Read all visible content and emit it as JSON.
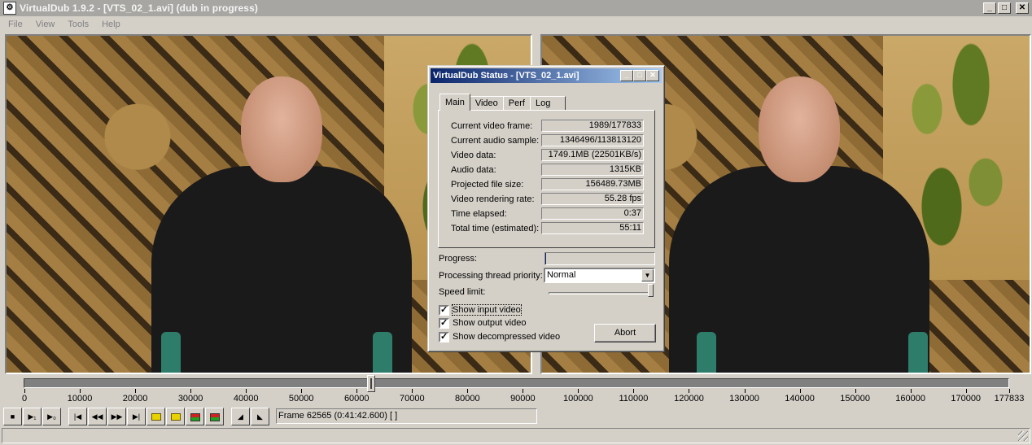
{
  "window": {
    "title": "VirtualDub 1.9.2 - [VTS_02_1.avi] (dub in progress)",
    "icon_glyph": "⚙",
    "minimize": "_",
    "maximize": "□",
    "close": "✕"
  },
  "menu": [
    "File",
    "View",
    "Tools",
    "Help"
  ],
  "status_dialog": {
    "title": "VirtualDub Status - [VTS_02_1.avi]",
    "tabs": [
      "Main",
      "Video",
      "Perf",
      "Log"
    ],
    "active_tab": "Main",
    "stats": [
      {
        "label": "Current video frame:",
        "value": "1989/177833"
      },
      {
        "label": "Current audio sample:",
        "value": "1346496/113813120"
      },
      {
        "label": "Video data:",
        "value": "1749.1MB (22501KB/s)"
      },
      {
        "label": "Audio data:",
        "value": "1315KB"
      },
      {
        "label": "Projected file size:",
        "value": "156489.73MB"
      },
      {
        "label": "Video rendering rate:",
        "value": "55.28 fps"
      },
      {
        "label": "Time elapsed:",
        "value": "0:37"
      },
      {
        "label": "Total time (estimated):",
        "value": "55:11"
      }
    ],
    "progress_label": "Progress:",
    "progress_fraction": 0.011,
    "priority_label": "Processing thread priority:",
    "priority_value": "Normal",
    "speed_label": "Speed limit:",
    "speed_fraction": 1.0,
    "checkboxes": [
      {
        "label": "Show input video",
        "checked": true
      },
      {
        "label": "Show output video",
        "checked": true
      },
      {
        "label": "Show decompressed video",
        "checked": true
      }
    ],
    "abort_label": "Abort"
  },
  "timeline": {
    "max": 177833,
    "position": 62565,
    "ticks": [
      "0",
      "10000",
      "20000",
      "30000",
      "40000",
      "50000",
      "60000",
      "70000",
      "80000",
      "90000",
      "100000",
      "110000",
      "120000",
      "130000",
      "140000",
      "150000",
      "160000",
      "170000",
      "177833"
    ]
  },
  "toolbar": {
    "buttons": [
      {
        "name": "stop-button",
        "glyph": "■"
      },
      {
        "name": "play-input-button",
        "glyph": "▶₁"
      },
      {
        "name": "play-output-button",
        "glyph": "▶₀"
      },
      {
        "name": "start-button",
        "glyph": "|◀"
      },
      {
        "name": "prev-frame-button",
        "glyph": "◀◀"
      },
      {
        "name": "next-frame-button",
        "glyph": "▶▶"
      },
      {
        "name": "end-button",
        "glyph": "▶|"
      },
      {
        "name": "prev-keyframe-button",
        "glyph": "key"
      },
      {
        "name": "next-keyframe-button",
        "glyph": "key"
      },
      {
        "name": "prev-scene-button",
        "glyph": "scene"
      },
      {
        "name": "next-scene-button",
        "glyph": "scene"
      },
      {
        "name": "mark-in-button",
        "glyph": "◢"
      },
      {
        "name": "mark-out-button",
        "glyph": "◣"
      }
    ],
    "frame_info": "Frame 62565 (0:41:42.600) [ ]"
  }
}
